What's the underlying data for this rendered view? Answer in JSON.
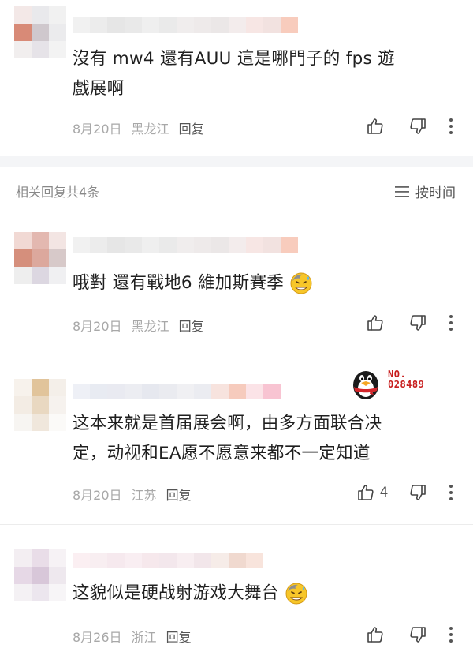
{
  "comments": [
    {
      "text": "沒有 mw4 還有AUU 這是哪門子的 fps 遊戲展啊",
      "date": "8月20日",
      "location": "黑龙江",
      "reply": "回复",
      "likes": "",
      "avatar_colors": [
        "#f3e8e7",
        "#e9e9ec",
        "#f1f1f1",
        "#d88a77",
        "#cfc8cd",
        "#ebebed",
        "#f1eeee",
        "#e6e3e8",
        "#f3f3f3"
      ],
      "name_colors": [
        "#f1f1f1",
        "#ececec",
        "#e6e6e6",
        "#e9e9e9",
        "#efefef",
        "#eaeaea",
        "#f0eded",
        "#eeeaea",
        "#ebe7e7",
        "#f3ecec",
        "#f7e6e4",
        "#f2e2e0",
        "#f8ccbd"
      ]
    },
    {
      "text": "哦對 還有戰地6 維加斯賽季",
      "has_emoji": true,
      "date": "8月20日",
      "location": "黑龙江",
      "reply": "回复",
      "likes": "",
      "avatar_colors": [
        "#f1d9d4",
        "#e3b8b0",
        "#f3e5e3",
        "#d58f7c",
        "#dca89d",
        "#d7c9c9",
        "#eeeeee",
        "#dcd7e1",
        "#f0f0f2"
      ],
      "name_colors": [
        "#f1f1f1",
        "#ececec",
        "#e6e6e6",
        "#e9e9e9",
        "#efefef",
        "#eaeaea",
        "#f0eded",
        "#eeeaea",
        "#ebe7e7",
        "#f3ecec",
        "#f7e6e4",
        "#f2e2e0",
        "#f8ccbd"
      ]
    },
    {
      "text": "这本来就是首届展会啊，由多方面联合决定，动视和EA愿不愿意来都不一定知道",
      "date": "8月20日",
      "location": "江苏",
      "reply": "回复",
      "likes": "4",
      "avatar_colors": [
        "#f7f2ec",
        "#e1c49b",
        "#f4efe9",
        "#f3ece4",
        "#e9d8c1",
        "#f6f2ee",
        "#f7f5f2",
        "#f0e7dc",
        "#fbfaf8"
      ],
      "name_colors": [
        "#eef0f6",
        "#e8ebf2",
        "#e9eaf1",
        "#ecedf2",
        "#e6e8ef",
        "#eaebf0",
        "#f0f0f3",
        "#ebecf1",
        "#f7e3de",
        "#f6cbbd",
        "#fbe3e7",
        "#f8c4d2"
      ]
    },
    {
      "text": "这貌似是硬战射游戏大舞台",
      "has_emoji": true,
      "date": "8月26日",
      "location": "浙江",
      "reply": "回复",
      "likes": "",
      "avatar_colors": [
        "#f3eef2",
        "#e9dde8",
        "#f6f2f5",
        "#e6d8e6",
        "#d8c7d9",
        "#eee8ee",
        "#f4f1f4",
        "#ece6ee",
        "#f7f5f7"
      ],
      "name_colors": [
        "#fbeff2",
        "#f8eef1",
        "#f6e9ee",
        "#f9eef2",
        "#f6e8ec",
        "#f3e7ec",
        "#f8eef1",
        "#f2e6ea",
        "#f6ece8",
        "#f0d9cf",
        "#f8e4dc"
      ]
    }
  ],
  "related_header": "相关回复共4条",
  "sort_label": "按时间",
  "badge_text_line1": "NO.",
  "badge_text_line2": "028489",
  "colors": {
    "accent": "#c81e1e",
    "meta": "#a8a8a8",
    "divider": "#f4f5f7"
  },
  "icons": [
    "thumbs-up-icon",
    "thumbs-down-icon",
    "more-vertical-icon",
    "sort-list-icon",
    "grin-sweat-emoji",
    "qq-penguin-badge"
  ]
}
